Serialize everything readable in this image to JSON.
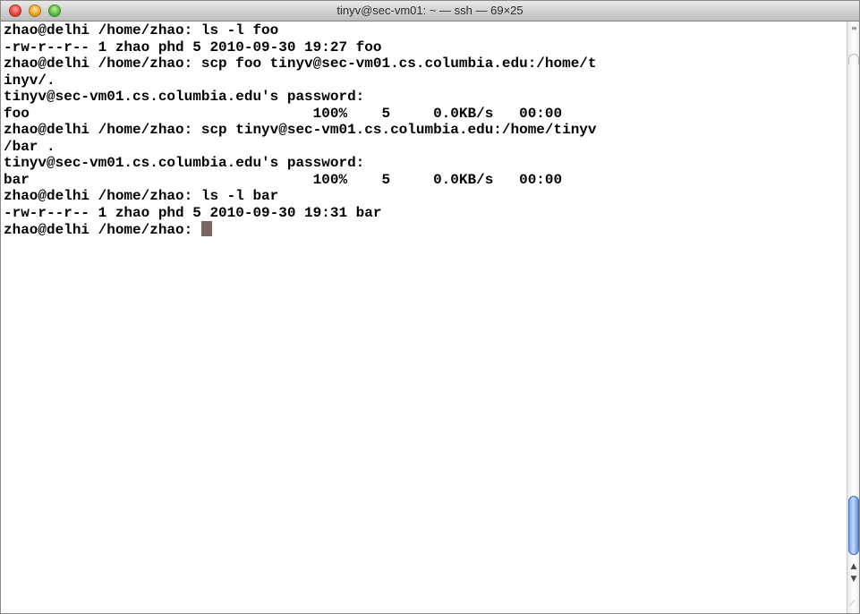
{
  "window": {
    "title": "tinyv@sec-vm01: ~ — ssh — 69×25"
  },
  "terminal": {
    "lines": [
      "zhao@delhi /home/zhao: ls -l foo",
      "-rw-r--r-- 1 zhao phd 5 2010-09-30 19:27 foo",
      "zhao@delhi /home/zhao: scp foo tinyv@sec-vm01.cs.columbia.edu:/home/t",
      "inyv/.",
      "tinyv@sec-vm01.cs.columbia.edu's password:",
      "foo                                 100%    5     0.0KB/s   00:00",
      "zhao@delhi /home/zhao: scp tinyv@sec-vm01.cs.columbia.edu:/home/tinyv",
      "/bar .",
      "tinyv@sec-vm01.cs.columbia.edu's password:",
      "bar                                 100%    5     0.0KB/s   00:00",
      "zhao@delhi /home/zhao: ls -l bar",
      "-rw-r--r-- 1 zhao phd 5 2010-09-30 19:31 bar"
    ],
    "prompt": "zhao@delhi /home/zhao: "
  },
  "icons": {
    "close": "close-button-icon",
    "minimize": "minimize-button-icon",
    "zoom": "zoom-button-icon",
    "split": "split-pane-icon",
    "up": "scroll-up-arrow-icon",
    "down": "scroll-down-arrow-icon",
    "grip": "resize-grip-icon"
  },
  "colors": {
    "cursor": "#7b6565",
    "scroll_thumb": "#6f9be6"
  }
}
